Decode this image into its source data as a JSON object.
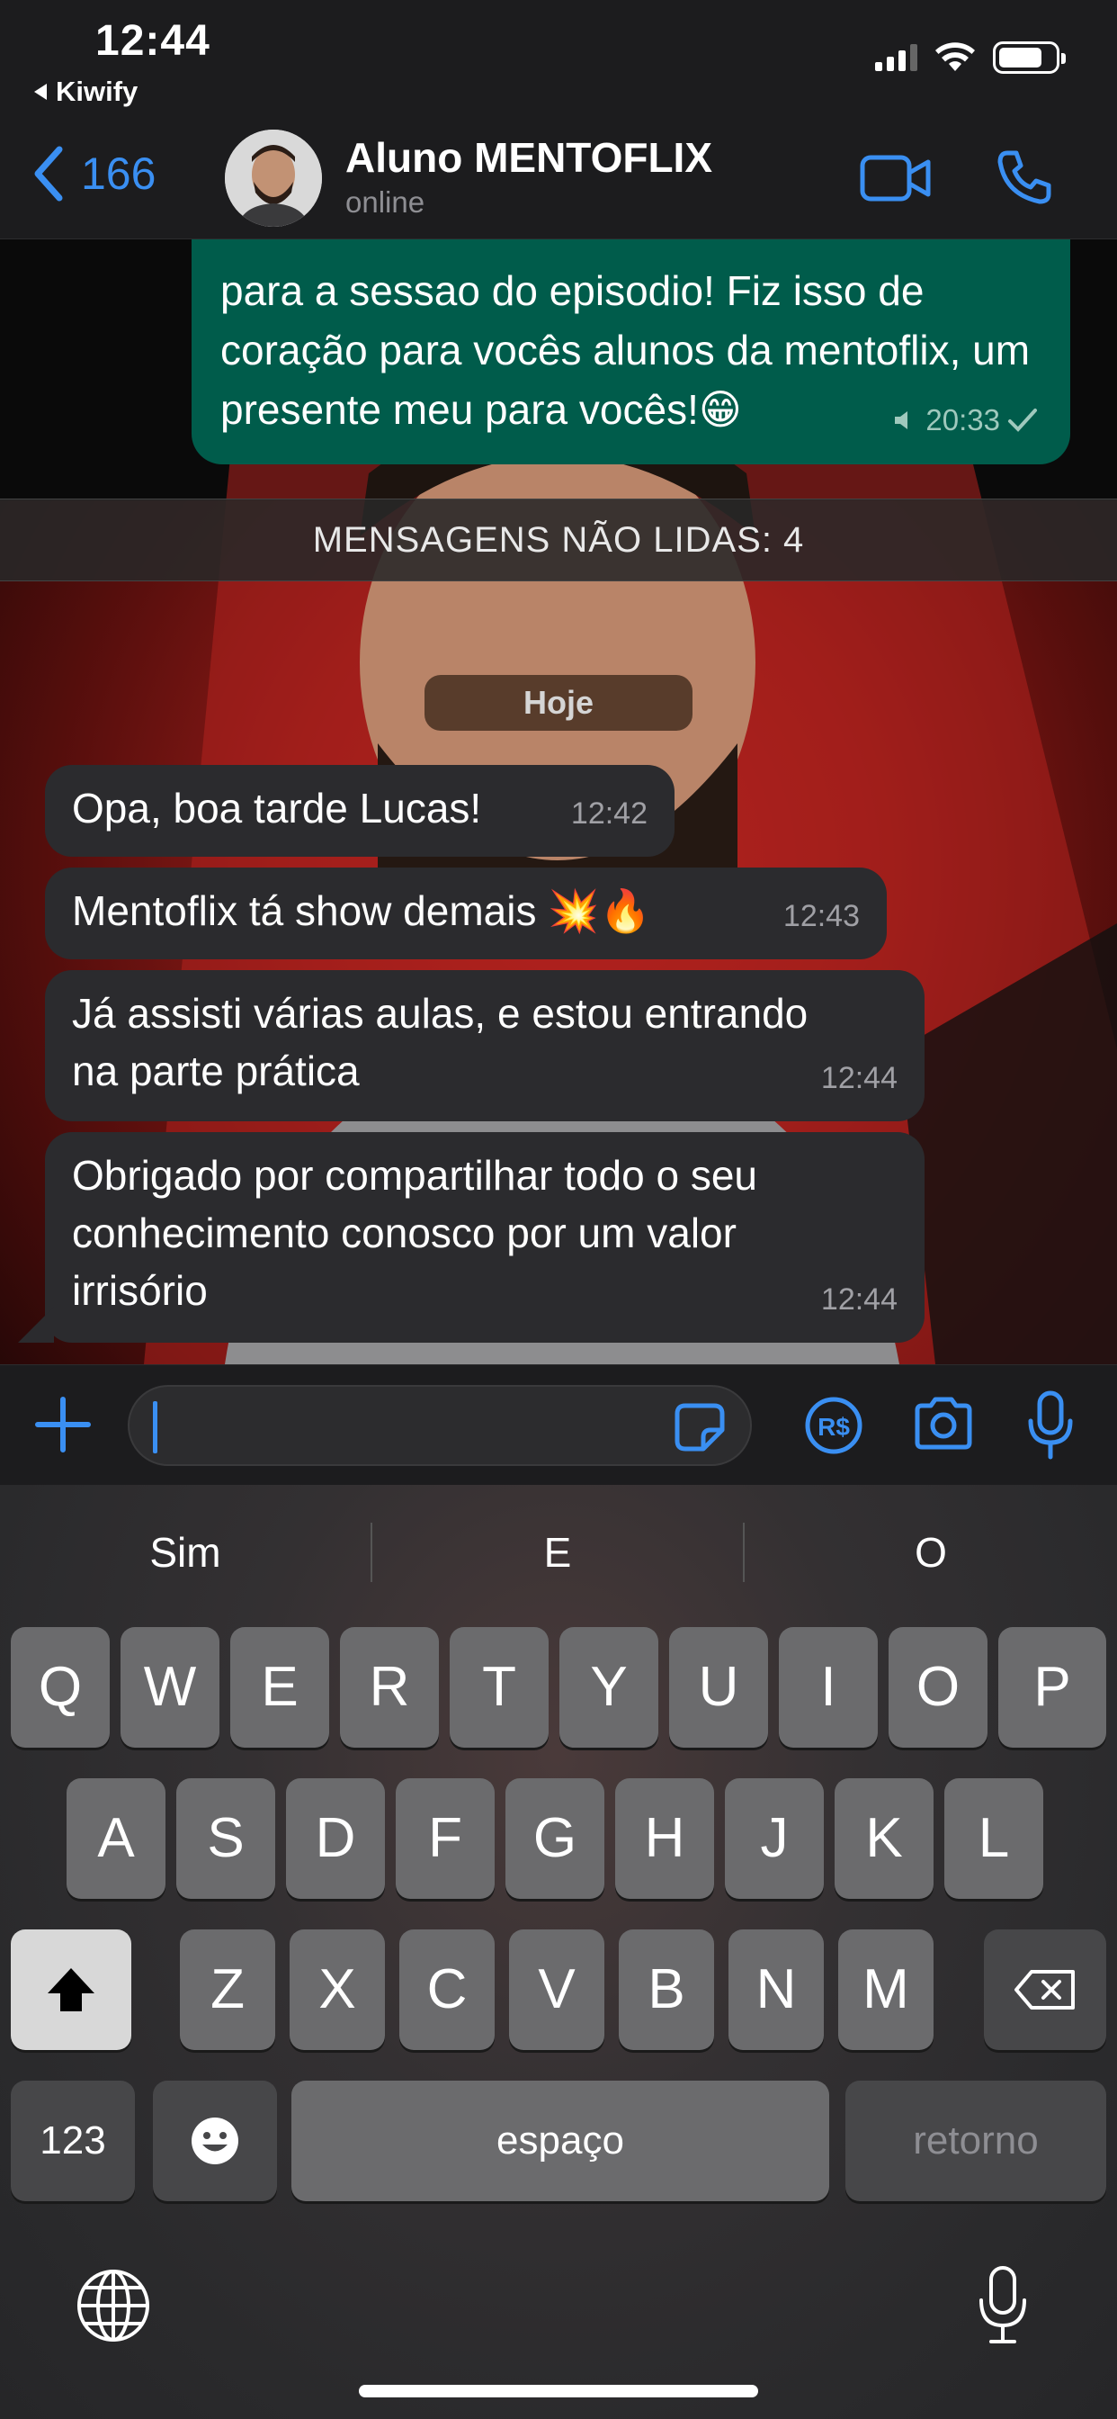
{
  "status_bar": {
    "time": "12:44",
    "back_app": "Kiwify"
  },
  "header": {
    "back_count": "166",
    "contact_name": "Aluno MENTOFLIX",
    "contact_status": "online"
  },
  "outgoing_message": {
    "text": "para a sessao do episodio!  Fiz isso de coração para vocês alunos da mentoflix, um presente meu para vocês!😁",
    "time": "20:33"
  },
  "unread_banner": "MENSAGENS NÃO LIDAS: 4",
  "day_label": "Hoje",
  "incoming_messages": [
    {
      "text": "Opa, boa tarde Lucas!",
      "time": "12:42"
    },
    {
      "text": "Mentoflix tá show demais 💥🔥",
      "time": "12:43"
    },
    {
      "text": "Já assisti várias aulas, e estou entrando na parte prática",
      "time": "12:44"
    },
    {
      "text": "Obrigado por compartilhar todo o seu conhecimento conosco por um valor irrisório",
      "time": "12:44"
    }
  ],
  "keyboard": {
    "suggestions": [
      "Sim",
      "E",
      "O"
    ],
    "row1": [
      "Q",
      "W",
      "E",
      "R",
      "T",
      "Y",
      "U",
      "I",
      "O",
      "P"
    ],
    "row2": [
      "A",
      "S",
      "D",
      "F",
      "G",
      "H",
      "J",
      "K",
      "L"
    ],
    "row3": [
      "Z",
      "X",
      "C",
      "V",
      "B",
      "N",
      "M"
    ],
    "numbers_key": "123",
    "space_key": "espaço",
    "return_key": "retorno"
  },
  "colors": {
    "accent": "#3a8ff2",
    "outgoing_bubble": "#005c4b",
    "incoming_bubble": "#2b2b2e"
  }
}
